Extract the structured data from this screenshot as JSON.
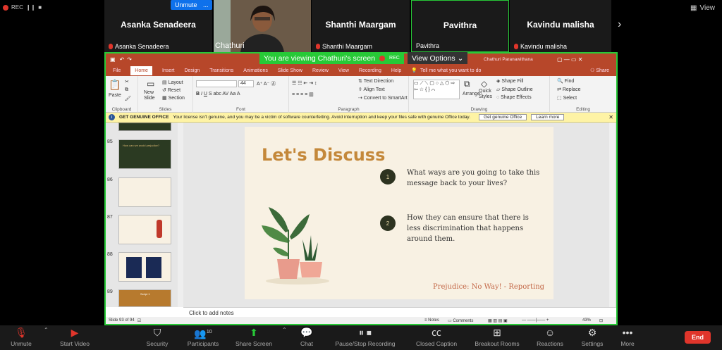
{
  "top": {
    "rec": "REC",
    "unmute": "Unmute",
    "more": "...",
    "view": "View",
    "participants": [
      {
        "name": "Asanka Senadeera",
        "sub": "Asanka Senadeera"
      },
      {
        "name": "",
        "sub": "Chathuri"
      },
      {
        "name": "Shanthi Maargam",
        "sub": "Shanthi Maargam"
      },
      {
        "name": "Pavithra",
        "sub": "Pavithra"
      },
      {
        "name": "Kavindu malisha",
        "sub": "Kavindu malisha"
      }
    ]
  },
  "share": {
    "viewing": "You are viewing Chathuri's screen",
    "rec": "REC",
    "view_options": "View Options",
    "account": "Chathuri Paranawithana",
    "tabs": [
      "File",
      "Home",
      "Insert",
      "Design",
      "Transitions",
      "Animations",
      "Slide Show",
      "Review",
      "View",
      "Recording",
      "Help"
    ],
    "tell_me": "Tell me what you want to do",
    "share": "Share",
    "groups": {
      "clipboard": "Clipboard",
      "slides": "Slides",
      "font": "Font",
      "paragraph": "Paragraph",
      "drawing": "Drawing",
      "editing": "Editing",
      "paste": "Paste",
      "new_slide": "New Slide",
      "layout": "Layout",
      "reset": "Reset",
      "section": "Section",
      "font_size": "44",
      "text_direction": "Text Direction",
      "align_text": "Align Text",
      "convert_smartart": "Convert to SmartArt",
      "arrange": "Arrange",
      "quick_styles": "Quick Styles",
      "shape_fill": "Shape Fill",
      "shape_outline": "Shape Outline",
      "shape_effects": "Shape Effects",
      "find": "Find",
      "replace": "Replace",
      "select": "Select"
    },
    "notice": {
      "title": "GET GENUINE OFFICE",
      "text": "Your license isn't genuine, and you may be a victim of software counterfeiting. Avoid interruption and keep your files safe with genuine Office today.",
      "btn1": "Get genuine Office",
      "btn2": "Learn more"
    },
    "thumb_nums": [
      "85",
      "86",
      "87",
      "88",
      "89"
    ],
    "thumb_texts": {
      "t85": "How can we avoid prejudice?",
      "t89": "Script 1"
    },
    "slide": {
      "title": "Let's Discuss",
      "q1_num": "1",
      "q1": "What ways are you going to take this message back to your lives?",
      "q2_num": "2",
      "q2": "How they can ensure that there is less discrimination that happens around them.",
      "footer": "Prejudice: No Way! - Reporting"
    },
    "notes": "Click to add notes",
    "status": {
      "slide": "Slide 93 of 94",
      "notes": "Notes",
      "comments": "Comments",
      "zoom": "43%"
    }
  },
  "bottom": {
    "items": [
      "Unmute",
      "Start Video",
      "Security",
      "Participants",
      "Share Screen",
      "Chat",
      "Pause/Stop Recording",
      "Closed Caption",
      "Breakout Rooms",
      "Reactions",
      "Settings",
      "More"
    ],
    "participants_count": "10",
    "end": "End"
  },
  "colors": {
    "accent_green": "#27c937",
    "ppt_red": "#b7472a",
    "zoom_red": "#e0352b",
    "slide_title": "#c4883a"
  }
}
